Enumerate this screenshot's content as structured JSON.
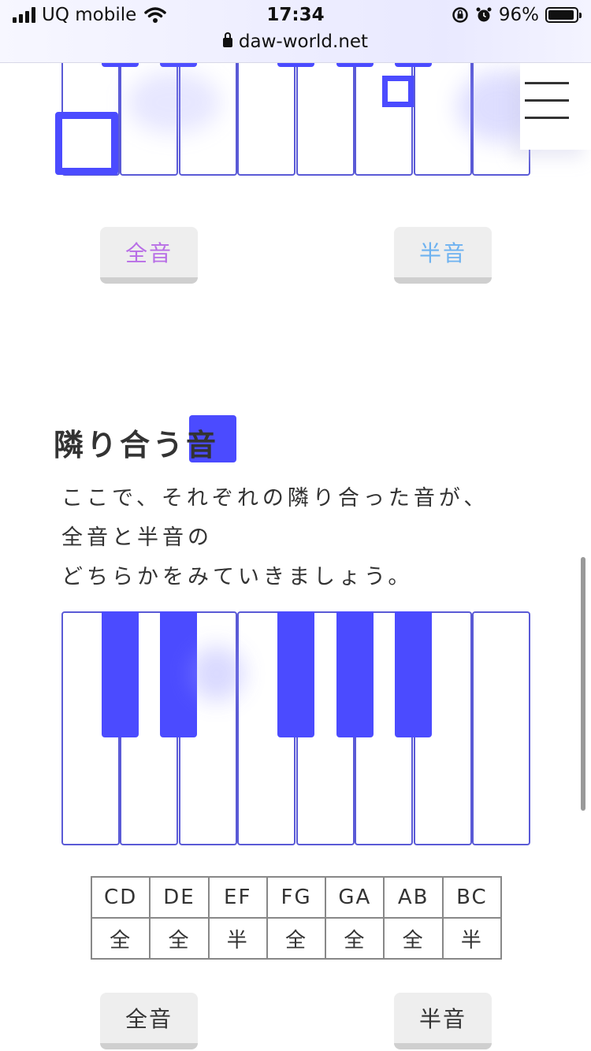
{
  "status_bar": {
    "carrier": "UQ mobile",
    "time": "17:34",
    "battery_pct": "96%",
    "url": "daw-world.net",
    "icons": [
      "signal-icon",
      "wifi-icon",
      "orientation-lock-icon",
      "alarm-icon",
      "battery-icon",
      "lock-icon"
    ]
  },
  "menu": {
    "icon": "hamburger-menu-icon"
  },
  "top_section": {
    "buttons": {
      "whole": "全音",
      "half": "半音"
    },
    "colors": {
      "whole": "#b86ee6",
      "half": "#6eb2f0"
    }
  },
  "adjacent_section": {
    "title": "隣り合う音",
    "paragraph": [
      "ここで、それぞれの隣り合った音が、",
      "全音と半音の",
      "どちらかをみていきましょう。"
    ],
    "table": {
      "pairs": [
        "CD",
        "DE",
        "EF",
        "FG",
        "GA",
        "AB",
        "BC"
      ],
      "types": [
        "全",
        "全",
        "半",
        "全",
        "全",
        "全",
        "半"
      ]
    },
    "buttons": {
      "whole": "全音",
      "half": "半音"
    }
  },
  "colors": {
    "accent": "#4b4bff",
    "key_border": "#5a5ad6"
  }
}
